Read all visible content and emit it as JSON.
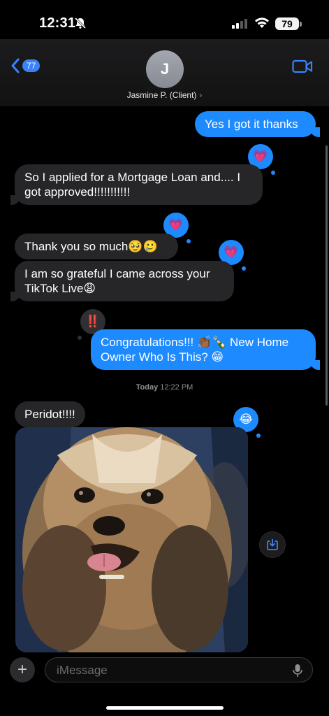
{
  "status_bar": {
    "time": "12:31",
    "battery": "79"
  },
  "header": {
    "back_count": "77",
    "avatar_initial": "J",
    "contact_name": "Jasmine P. (Client)",
    "chevron": "›"
  },
  "messages": [
    {
      "text": "Yes I got it thanks"
    },
    {
      "text": "So I applied for a Mortgage Loan and.... I got approved!!!!!!!!!!!"
    },
    {
      "text": "Thank you so much🥹🥲"
    },
    {
      "text": "I am so grateful I came across your TikTok Live😩"
    },
    {
      "text": "Congratulations!!! 👏🏾🍾 New Home Owner Who Is This? 😁"
    },
    {
      "text": "Peridot!!!!"
    }
  ],
  "tapbacks": {
    "heart": "💗",
    "exclaim": "‼️",
    "laugh": "😂"
  },
  "timestamp": {
    "day": "Today",
    "time": "12:22 PM"
  },
  "input": {
    "placeholder": "iMessage",
    "plus": "+"
  },
  "colors": {
    "accent": "#1e8aff",
    "incoming": "#262628",
    "background": "#000000"
  }
}
